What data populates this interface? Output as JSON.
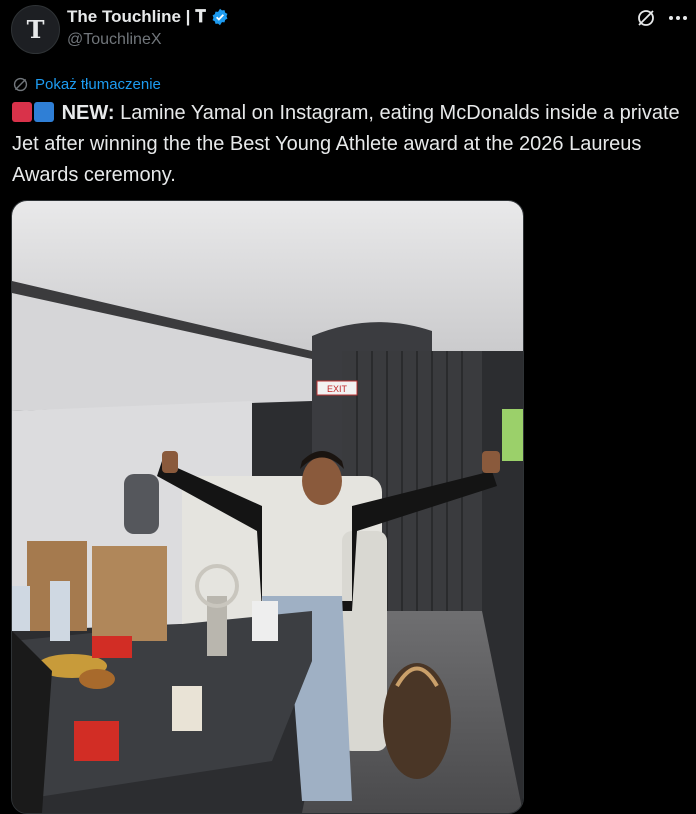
{
  "author": {
    "display_name": "The Touchline | 𝐓",
    "handle": "@TouchlineX",
    "avatar_letter": "T"
  },
  "actions": {
    "grok_icon": "grok-slash-icon",
    "more_icon": "ellipsis-icon"
  },
  "translate": {
    "label": "Pokaż tłumaczenie",
    "icon": "globe-translate-icon"
  },
  "tweet": {
    "lead_emojis": [
      "siren-emoji",
      "phone-emoji"
    ],
    "new_label": "NEW:",
    "body": " Lamine Yamal on Instagram, eating McDonalds inside a private Jet after winning the the Best Young Athlete award at the 2026 Laureus Awards ceremony."
  },
  "media": {
    "type": "photo",
    "exit_sign": "EXIT"
  },
  "colors": {
    "background": "#000000",
    "text": "#e7e9ea",
    "muted": "#71767b",
    "accent": "#1d9bf0"
  }
}
